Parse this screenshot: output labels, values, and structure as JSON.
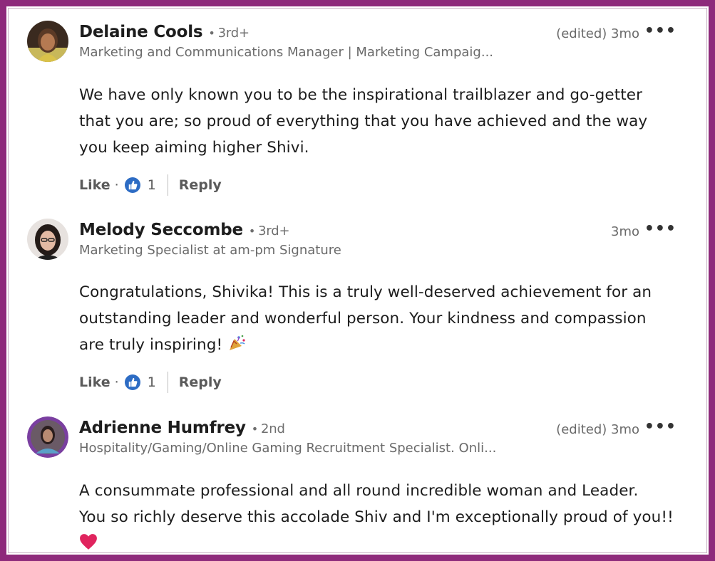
{
  "comments": [
    {
      "name": "Delaine Cools",
      "degree": "3rd+",
      "headline": "Marketing and Communications Manager | Marketing Campaig...",
      "meta": "(edited) 3mo",
      "lines": [
        "We have only known you to be the inspirational trailblazer and go-getter",
        "that you are; so proud of everything that you have achieved and the way",
        "you keep aiming higher Shivi."
      ],
      "like_label": "Like",
      "like_count": "1",
      "reply_label": "Reply",
      "more": "•••"
    },
    {
      "name": "Melody Seccombe",
      "degree": "3rd+",
      "headline": "Marketing Specialist at am-pm Signature",
      "meta": "3mo",
      "lines": [
        "Congratulations, Shivika! This is a truly well-deserved achievement for an",
        "outstanding leader and wonderful person. Your kindness and compassion",
        "are truly inspiring!"
      ],
      "like_label": "Like",
      "like_count": "1",
      "reply_label": "Reply",
      "more": "•••",
      "emoji": "party-popper-icon"
    },
    {
      "name": "Adrienne Humfrey",
      "degree": "2nd",
      "headline": "Hospitality/Gaming/Online Gaming Recruitment Specialist. Onli...",
      "meta": "(edited) 3mo",
      "lines": [
        "A consummate professional and all round incredible woman and Leader.",
        "You so richly deserve this accolade Shiv and I'm exceptionally proud of you!!"
      ],
      "more": "•••",
      "emoji": "red-heart-icon"
    }
  ],
  "colors": {
    "frame": "#8e2a7b",
    "like_badge": "#2d6cc4",
    "heart": "#e0245e"
  }
}
